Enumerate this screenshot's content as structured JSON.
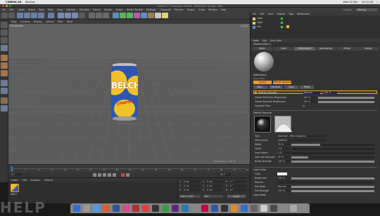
{
  "mac_menu": {
    "app": "CINEMA 4D",
    "window": "Window",
    "right_date": "Wed 22 Mar",
    "right_time": "10:01:08"
  },
  "window_title": "Untitled 1 * (Classroom Version - Restricted License) - Main",
  "menus": [
    "File",
    "Edit",
    "Create",
    "Select",
    "Tools",
    "Mesh",
    "Snap",
    "Animate",
    "Simulate",
    "Tracker",
    "Render",
    "Sculpt",
    "Motion Tracker",
    "MoGraph",
    "Character",
    "Pipeline",
    "Plugins",
    "Script",
    "Window",
    "Help"
  ],
  "layout": {
    "label": "Layout:",
    "value": "Startup"
  },
  "viewport_menu": [
    "View",
    "Cameras",
    "Display",
    "Options",
    "Filter",
    "Panel"
  ],
  "viewport_label": "Perspective",
  "grid_spacing": "Grid Spacing : 100 cm",
  "can": {
    "brand": "BELCH",
    "sub": "J!PAPOP"
  },
  "object_manager": {
    "menu": [
      "File",
      "Edit",
      "View",
      "Objects",
      "Tags",
      "Bookmarks"
    ],
    "objects": [
      "Light",
      "Light",
      "Can"
    ]
  },
  "attributes": {
    "menu": [
      "Mode",
      "Edit",
      "User Data"
    ],
    "title": "Material [Mat.1]",
    "tabs": [
      "Basic",
      "Color",
      "Reflectance",
      "Illumination",
      "Editor",
      "Assign"
    ],
    "section": "Reflectance",
    "layer_label": "Layer Mode",
    "layer_tabs": [
      "Layers",
      "Default Specular"
    ],
    "buttons": [
      "Add...",
      "Remove",
      "Copy",
      "Paste"
    ],
    "layer_row": "Default Specular",
    "layer_mode": "Normal",
    "layer_pct": "100 %",
    "global_rows": [
      {
        "label": "Global Reflection Brightness",
        "value": "100 %"
      },
      {
        "label": "Global Specular Brightness",
        "value": "100 %"
      },
      {
        "label": "Separate Pass",
        "value": ""
      }
    ],
    "default_specular": "Default Specular",
    "params": [
      {
        "label": "Type",
        "value": "Specular - Blinn (Legacy)",
        "fill": 0
      },
      {
        "label": "Attenuation",
        "value": "Additive",
        "fill": 0
      },
      {
        "label": "Width",
        "value": "35 %",
        "fill": 0.35
      },
      {
        "label": "Falloff",
        "value": "0 %",
        "fill": 0
      },
      {
        "label": "Inner Width",
        "value": "0 %",
        "fill": 0
      },
      {
        "label": "Specular Strength",
        "value": "20 %",
        "fill": 0.2
      },
      {
        "label": "Bump Strength",
        "value": "100 %",
        "fill": 1
      }
    ],
    "layer_color": "Layer Color",
    "color_rows": [
      {
        "label": "Color",
        "value": ""
      },
      {
        "label": "Brightness",
        "value": "100 %"
      },
      {
        "label": "Texture",
        "value": ""
      },
      {
        "label": "Mix Mode",
        "value": "Normal"
      },
      {
        "label": "Mix Strength",
        "value": "100 %"
      }
    ],
    "layer_mask": "Layer Mask"
  },
  "timeline": {
    "ticks": [
      "0",
      "5",
      "10",
      "15",
      "20",
      "25",
      "30",
      "35",
      "40",
      "45",
      "50",
      "55",
      "60",
      "65",
      "70",
      "75",
      "80",
      "85",
      "90"
    ],
    "start": "0 F",
    "end": "90 F"
  },
  "material_manager": {
    "menu": [
      "Create",
      "Edit",
      "Function",
      "Texture"
    ],
    "material": "Mat.1"
  },
  "coordinates": {
    "rows": [
      {
        "a": "X",
        "v1": "0 cm",
        "b": "X",
        "v2": "0 cm",
        "c": "H",
        "v3": "0 °"
      },
      {
        "a": "Y",
        "v1": "0 cm",
        "b": "Y",
        "v2": "0 cm",
        "c": "P",
        "v3": "0 °"
      },
      {
        "a": "Z",
        "v1": "0 cm",
        "b": "Z",
        "v2": "0 cm",
        "c": "B",
        "v3": "0 °"
      }
    ],
    "mode": "Object (Rel)",
    "size": "Size",
    "apply": "Apply"
  },
  "watermark": "HELP",
  "colors": {
    "accent": "#f0a020",
    "viewport": "#5a5a5a",
    "panel": "#333333"
  }
}
